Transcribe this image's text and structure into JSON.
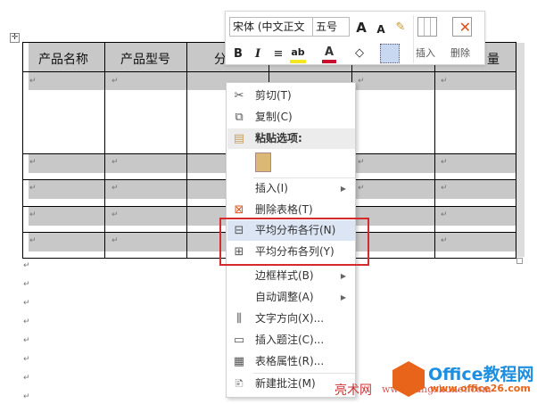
{
  "table": {
    "headers": [
      "产品名称",
      "产品型号",
      "分",
      "量"
    ],
    "para_mark": "↵",
    "move_handle": "✛"
  },
  "toolbar": {
    "font_name": "宋体 (中文正文",
    "font_size": "五号",
    "grow_font": "A",
    "shrink_font": "A",
    "bold": "B",
    "italic": "I",
    "insert_label": "插入",
    "delete_label": "删除"
  },
  "menu": {
    "items": [
      {
        "label": "剪切(T)",
        "icon": "scissors-icon"
      },
      {
        "label": "复制(C)",
        "icon": "copy-icon"
      },
      {
        "label": "粘贴选项:",
        "icon": "paste-icon"
      },
      {
        "label": "插入(I)",
        "icon": ""
      },
      {
        "label": "删除表格(T)",
        "icon": "delete-table-icon"
      },
      {
        "label": "平均分布各行(N)",
        "icon": "distribute-rows-icon"
      },
      {
        "label": "平均分布各列(Y)",
        "icon": "distribute-columns-icon"
      },
      {
        "label": "边框样式(B)",
        "icon": ""
      },
      {
        "label": "自动调整(A)",
        "icon": ""
      },
      {
        "label": "文字方向(X)...",
        "icon": "text-direction-icon"
      },
      {
        "label": "插入题注(C)...",
        "icon": "caption-icon"
      },
      {
        "label": "表格属性(R)...",
        "icon": "table-properties-icon"
      },
      {
        "label": "新建批注(M)",
        "icon": "comment-icon"
      }
    ]
  },
  "watermark": {
    "site_cn": "亮术网",
    "url": "www.liangshunet.com",
    "brand": "Office教程网",
    "brand_url": "www.office26.com"
  },
  "colors": {
    "highlight": "#dbe5f3",
    "red_box": "#d62b2b",
    "brand": "#e8641b"
  }
}
